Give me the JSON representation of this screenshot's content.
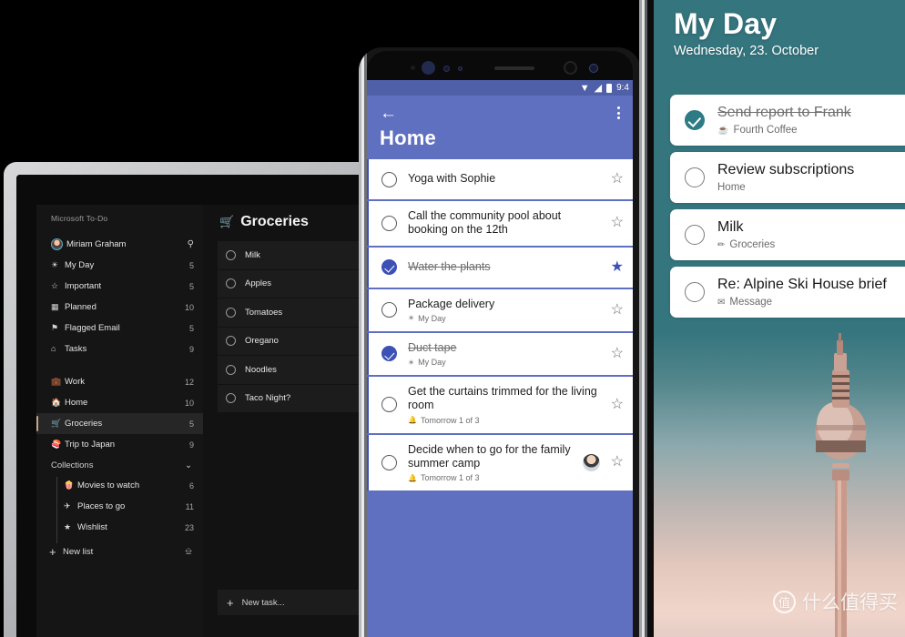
{
  "desktop": {
    "brand": "Microsoft To-Do",
    "account": {
      "name": "Miriam Graham",
      "search_icon": "search-icon"
    },
    "smart_lists": [
      {
        "icon": "sun-icon",
        "glyph": "☀",
        "label": "My Day",
        "count": "5"
      },
      {
        "icon": "star-icon",
        "glyph": "☆",
        "label": "Important",
        "count": "5"
      },
      {
        "icon": "calendar-icon",
        "glyph": "▦",
        "label": "Planned",
        "count": "10"
      },
      {
        "icon": "flag-icon",
        "glyph": "⚑",
        "label": "Flagged Email",
        "count": "5"
      },
      {
        "icon": "home-icon",
        "glyph": "⌂",
        "label": "Tasks",
        "count": "9"
      }
    ],
    "user_lists": [
      {
        "icon": "briefcase-icon",
        "glyph": "💼",
        "label": "Work",
        "count": "12",
        "active": false
      },
      {
        "icon": "house-icon",
        "glyph": "🏠",
        "label": "Home",
        "count": "10",
        "active": false
      },
      {
        "icon": "basket-icon",
        "glyph": "🛒",
        "label": "Groceries",
        "count": "5",
        "active": true
      },
      {
        "icon": "sushi-icon",
        "glyph": "🍣",
        "label": "Trip to Japan",
        "count": "9",
        "active": false
      }
    ],
    "collections": {
      "label": "Collections",
      "chevron_icon": "chevron-down-icon",
      "items": [
        {
          "icon": "popcorn-icon",
          "glyph": "🍿",
          "label": "Movies to watch",
          "count": "6"
        },
        {
          "icon": "plane-icon",
          "glyph": "✈",
          "label": "Places to go",
          "count": "11"
        },
        {
          "icon": "star-icon",
          "glyph": "★",
          "label": "Wishlist",
          "count": "23"
        }
      ]
    },
    "new_list": {
      "label": "New list",
      "plus_icon": "plus-icon",
      "group_icon": "new-group-icon"
    },
    "list_view": {
      "icon": "basket-icon",
      "glyph": "🛒",
      "title": "Groceries",
      "tasks": [
        {
          "title": "Milk"
        },
        {
          "title": "Apples"
        },
        {
          "title": "Tomatoes"
        },
        {
          "title": "Oregano"
        },
        {
          "title": "Noodles"
        },
        {
          "title": "Taco Night?"
        }
      ],
      "new_task_placeholder": "New task..."
    }
  },
  "phone": {
    "status_bar": {
      "wifi_icon": "wifi-icon",
      "signal_icon": "signal-icon",
      "battery_icon": "battery-icon",
      "time": "9:4"
    },
    "app_bar": {
      "back_icon": "back-arrow-icon",
      "menu_icon": "overflow-menu-icon",
      "title": "Home"
    },
    "tasks": [
      {
        "title": "Yoga with Sophie",
        "meta": "",
        "meta_icon": "",
        "done": false,
        "starred": false,
        "avatar": false
      },
      {
        "title": "Call the community pool about booking on the 12th",
        "meta": "",
        "meta_icon": "",
        "done": false,
        "starred": false,
        "avatar": false
      },
      {
        "title": "Water the plants",
        "meta": "",
        "meta_icon": "",
        "done": true,
        "starred": true,
        "avatar": false
      },
      {
        "title": "Package delivery",
        "meta": "My Day",
        "meta_icon": "sun-icon",
        "meta_glyph": "☀",
        "done": false,
        "starred": false,
        "avatar": false
      },
      {
        "title": "Duct tape",
        "meta": "My Day",
        "meta_icon": "sun-icon",
        "meta_glyph": "☀",
        "done": true,
        "starred": false,
        "avatar": false
      },
      {
        "title": "Get the curtains trimmed for the living room",
        "meta": "Tomorrow  1 of 3",
        "meta_icon": "bell-icon",
        "meta_glyph": "🔔",
        "done": false,
        "starred": false,
        "avatar": false
      },
      {
        "title": "Decide when to go for the family summer camp",
        "meta": "Tomorrow  1 of 3",
        "meta_icon": "bell-icon",
        "meta_glyph": "🔔",
        "done": false,
        "starred": false,
        "avatar": true
      }
    ]
  },
  "tablet": {
    "header": {
      "title": "My Day",
      "date": "Wednesday, 23. October"
    },
    "tasks": [
      {
        "title": "Send report to Frank",
        "meta": "Fourth Coffee",
        "meta_icon": "coffee-icon",
        "meta_glyph": "☕",
        "done": true
      },
      {
        "title": "Review subscriptions",
        "meta": "Home",
        "meta_icon": "",
        "meta_glyph": "",
        "done": false
      },
      {
        "title": "Milk",
        "meta": "Groceries",
        "meta_icon": "pencil-icon",
        "meta_glyph": "✏",
        "done": false
      },
      {
        "title": "Re: Alpine Ski House brief",
        "meta": "Message",
        "meta_icon": "envelope-icon",
        "meta_glyph": "✉",
        "done": false
      }
    ],
    "photo_caption": "berlin-tv-tower-photo"
  },
  "watermark": {
    "badge": "值",
    "text": "什么值得买"
  },
  "colors": {
    "phone_accent": "#3d50b5",
    "phone_header": "#6070c0",
    "tablet_accent": "#2d7b84",
    "tablet_hero": "#35757e",
    "desktop_bg": "#0b0b0b",
    "desktop_panel": "#121212",
    "list_active": "#c9a58a"
  }
}
